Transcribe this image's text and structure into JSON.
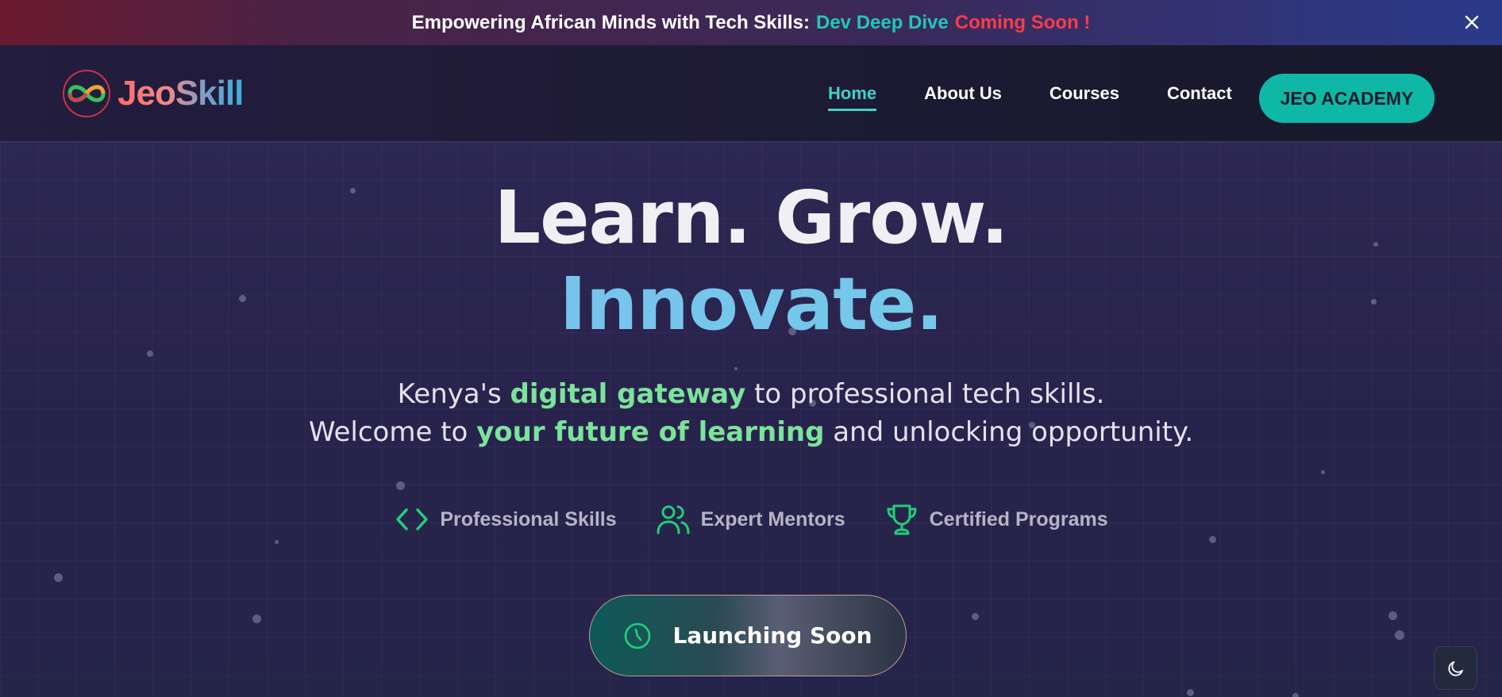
{
  "announcement": {
    "text": "Empowering African Minds with Tech Skills:",
    "highlight": "Dev Deep Dive",
    "suffix": "Coming Soon !",
    "close_icon": "close-icon"
  },
  "header": {
    "logo_text": "JeoSkill",
    "logo_icon": "infinity-logo-icon",
    "nav": [
      {
        "label": "Home",
        "active": true
      },
      {
        "label": "About Us",
        "active": false
      },
      {
        "label": "Courses",
        "active": false
      },
      {
        "label": "Contact",
        "active": false
      }
    ],
    "cta_label": "JEO ACADEMY"
  },
  "hero": {
    "title_line1": "Learn. Grow.",
    "title_line2": "Innovate.",
    "subtitle_line1": {
      "before": "Kenya's",
      "highlight": "digital gateway",
      "after": "to professional tech skills."
    },
    "subtitle_line2": {
      "before": "Welcome to",
      "highlight": "your future of learning",
      "after": "and unlocking opportunity."
    },
    "features": [
      {
        "label": "Professional Skills",
        "icon": "code-icon"
      },
      {
        "label": "Expert Mentors",
        "icon": "users-icon"
      },
      {
        "label": "Certified Programs",
        "icon": "trophy-icon"
      }
    ],
    "launch_label": "Launching Soon",
    "launch_icon": "clock-icon"
  },
  "theme_toggle_icon": "moon-icon",
  "colors": {
    "accent_teal": "#0fb7a6",
    "accent_green": "#7be39b",
    "accent_red": "#ff3b4a",
    "feature_icon": "#1fd07a"
  }
}
